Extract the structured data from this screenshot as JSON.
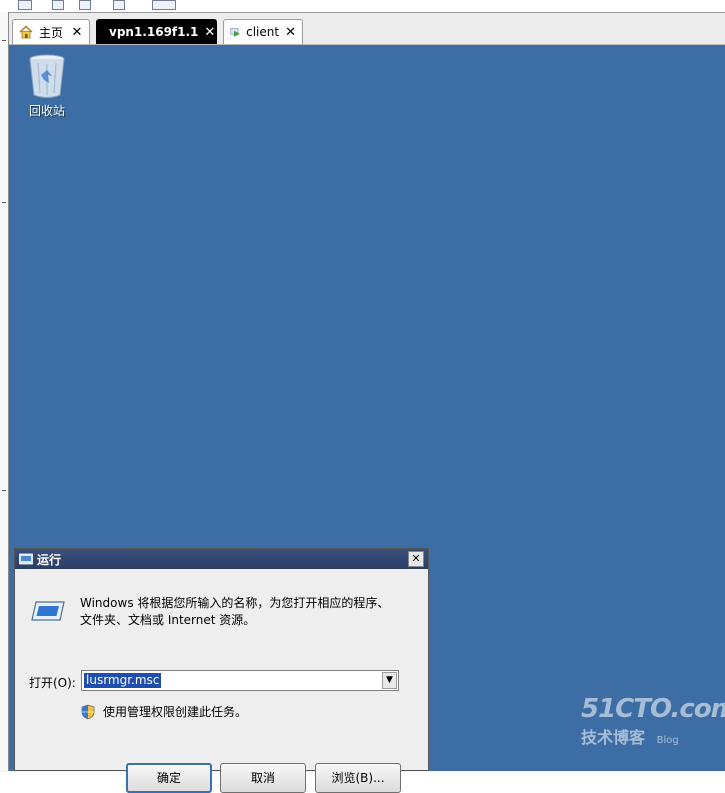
{
  "tabs": [
    {
      "label": "主页",
      "icon": "home-icon",
      "close": "✕"
    },
    {
      "label": "vpn1.169f1.1",
      "icon": "vm-network-icon",
      "close": "✕"
    },
    {
      "label": "client",
      "icon": "vm-running-icon",
      "close": "✕"
    }
  ],
  "desktop": {
    "recycle_bin_label": "回收站",
    "background_color": "#3c6ea5"
  },
  "watermark": {
    "site": "51CTO.com",
    "tagline": "技术博客",
    "blog": "Blog"
  },
  "run_dialog": {
    "title": "运行",
    "close": "✕",
    "description_line1": "Windows 将根据您所输入的名称，为您打开相应的程序、",
    "description_line2": "文件夹、文档或 Internet 资源。",
    "open_label": "打开(O):",
    "input_value": "lusrmgr.msc",
    "dropdown_arrow": "▼",
    "admin_note": "使用管理权限创建此任务。",
    "ok_label": "确定",
    "cancel_label": "取消",
    "browse_label": "浏览(B)..."
  }
}
